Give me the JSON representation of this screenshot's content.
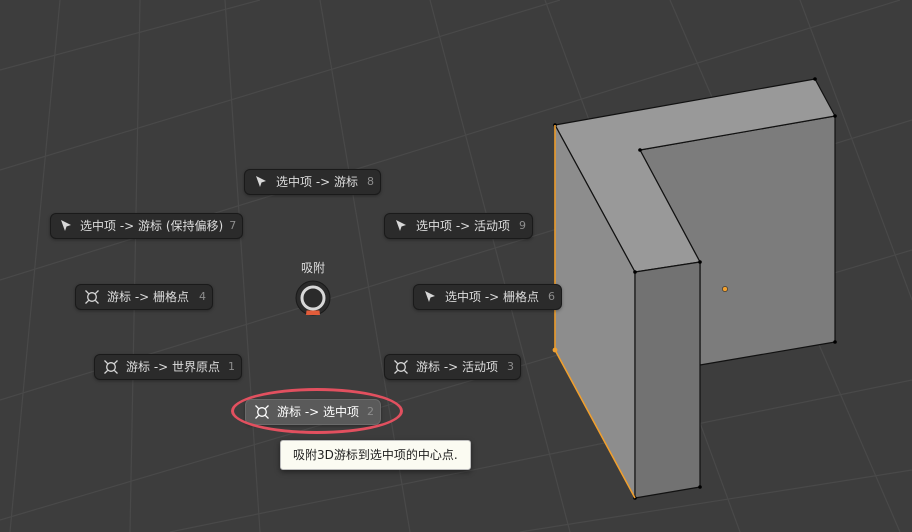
{
  "pie_menu": {
    "title": "吸附",
    "items": [
      {
        "label": "选中项 -> 游标",
        "key": "8",
        "icon": "cursor-arrow-icon"
      },
      {
        "label": "选中项 -> 游标 (保持偏移)",
        "key": "7",
        "icon": "cursor-arrow-icon"
      },
      {
        "label": "选中项 -> 活动项",
        "key": "9",
        "icon": "cursor-arrow-icon"
      },
      {
        "label": "游标 -> 栅格点",
        "key": "4",
        "icon": "3d-cursor-icon"
      },
      {
        "label": "选中项 -> 栅格点",
        "key": "6",
        "icon": "cursor-arrow-icon"
      },
      {
        "label": "游标 -> 世界原点",
        "key": "1",
        "icon": "3d-cursor-icon"
      },
      {
        "label": "游标 -> 活动项",
        "key": "3",
        "icon": "3d-cursor-icon"
      },
      {
        "label": "游标 -> 选中项",
        "key": "2",
        "icon": "3d-cursor-icon"
      }
    ],
    "active_item_key": "2"
  },
  "tooltip": {
    "text": "吸附3D游标到选中项的中心点."
  },
  "colors": {
    "viewport_bg": "#3d3d3d",
    "grid_line": "#494949",
    "highlight_ring": "#e2505f",
    "selection_orange": "#f0a030",
    "dial_accent": "#e25c3a"
  }
}
